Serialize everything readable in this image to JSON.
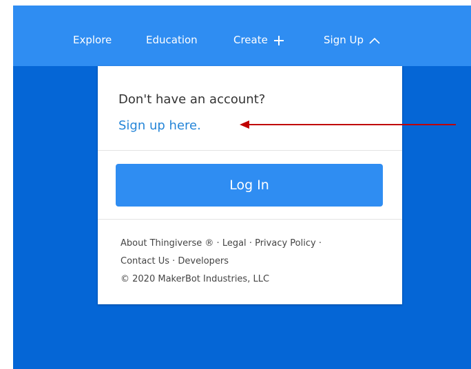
{
  "nav": {
    "items": [
      {
        "label": "Explore"
      },
      {
        "label": "Education"
      },
      {
        "label": "Create"
      },
      {
        "label": "Sign Up"
      }
    ]
  },
  "dropdown": {
    "prompt": "Don't have an account?",
    "signup_link": "Sign up here.",
    "login_button": "Log In",
    "footer": {
      "about": "About Thingiverse ®",
      "legal": "Legal",
      "privacy": "Privacy Policy",
      "contact": "Contact Us",
      "developers": "Developers",
      "sep": "·",
      "copyright": "© 2020 MakerBot Industries, LLC"
    }
  },
  "colors": {
    "topbar": "#2f8df2",
    "background": "#0566d6",
    "link": "#2585d8",
    "arrow": "#c00000"
  }
}
